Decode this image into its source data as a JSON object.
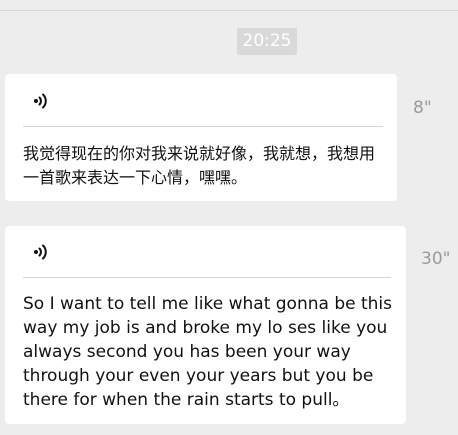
{
  "chat": {
    "timestamp": "20:25",
    "messages": [
      {
        "type": "voice",
        "icon": "voice-icon",
        "duration": "8\"",
        "transcript": "我觉得现在的你对我来说就好像，我就想，我想用一首歌来表达一下心情，嘿嘿。"
      },
      {
        "type": "voice",
        "icon": "voice-icon",
        "duration": "30\"",
        "transcript": "So I want to tell me like what gonna be this way my job is and broke my lo ses like you always second you has been your way through your even your years but you be there for when the rain starts to pull。"
      }
    ]
  },
  "colors": {
    "background": "#ededed",
    "bubble": "#ffffff",
    "divider": "#d6d6d6",
    "timestamp_bg": "#d9d9d9",
    "duration_text": "#9a9a9a",
    "text": "#111111"
  }
}
